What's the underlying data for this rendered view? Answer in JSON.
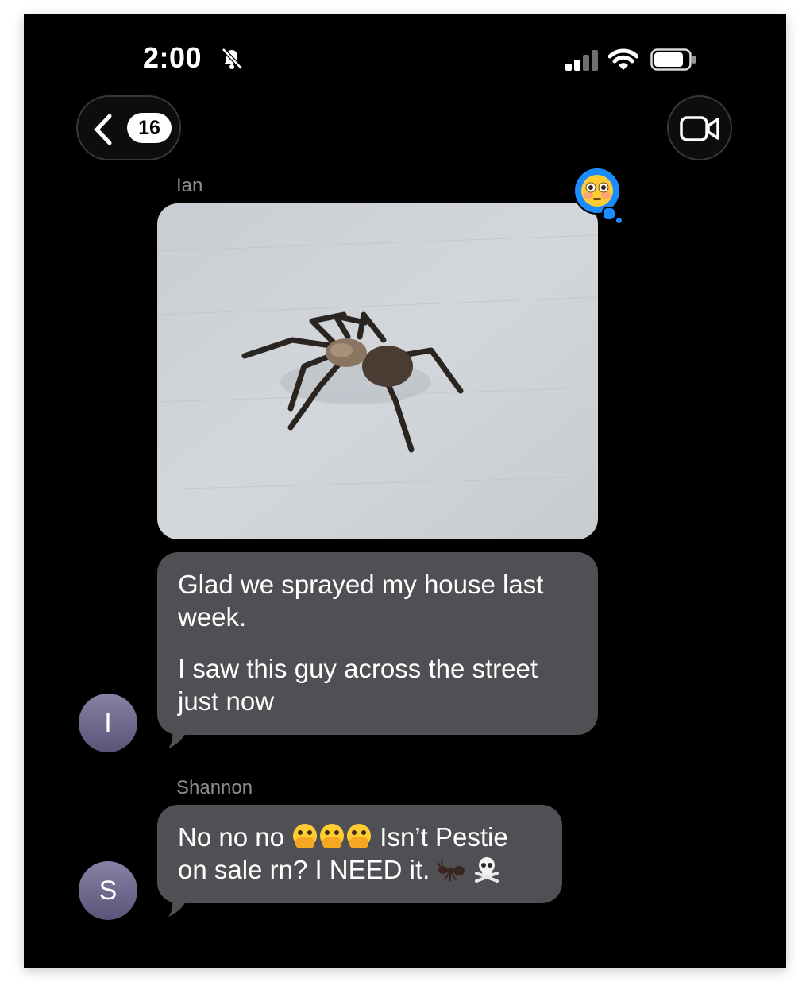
{
  "status_bar": {
    "time": "2:00",
    "icons": [
      "bell-slash-icon",
      "cellular-signal-icon",
      "wifi-icon",
      "battery-icon"
    ]
  },
  "nav": {
    "back_icon": "chevron-left-icon",
    "unread_count": "16",
    "video_icon": "video-camera-icon"
  },
  "messages": [
    {
      "sender": "Ian",
      "avatar_initial": "I",
      "photo": "spider-photo",
      "tapback": "flushed-face-emoji",
      "paragraphs": [
        "Glad we sprayed my house last week.",
        "I saw this guy across the street just now"
      ]
    },
    {
      "sender": "Shannon",
      "avatar_initial": "S",
      "text_line1_a": "No no no",
      "text_line1_b": "Isn’t Pestie",
      "text_line2": "on sale rn? I NEED it.",
      "emojis": [
        "face-with-open-eyes-and-hand-over-mouth-emoji",
        "face-with-open-eyes-and-hand-over-mouth-emoji",
        "face-with-open-eyes-and-hand-over-mouth-emoji",
        "ant-emoji",
        "skull-and-crossbones-emoji"
      ]
    }
  ],
  "colors": {
    "background": "#000000",
    "bubble_gray": "#505054",
    "tapback_blue": "#1a8cff",
    "sender_name": "#8e8e93"
  }
}
